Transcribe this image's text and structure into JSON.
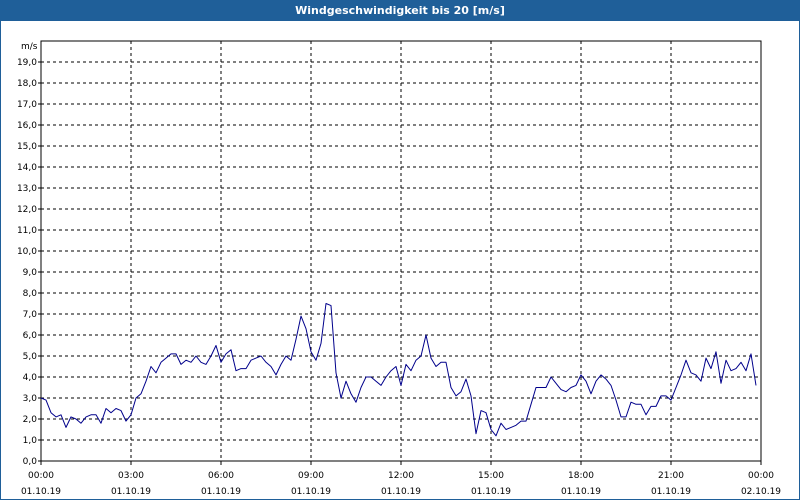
{
  "window": {
    "title": "Windgeschwindigkeit bis 20 [m/s]"
  },
  "colors": {
    "title_bar": "#1f5f99",
    "series_line": "#00008b",
    "grid": "#000000"
  },
  "chart_data": {
    "type": "line",
    "title": "Windgeschwindigkeit bis 20 [m/s]",
    "ylabel": "m/s",
    "xlabel": "",
    "ylim": [
      0,
      20
    ],
    "y_ticks": [
      "0,0",
      "1,0",
      "2,0",
      "3,0",
      "4,0",
      "5,0",
      "6,0",
      "7,0",
      "8,0",
      "9,0",
      "10,0",
      "11,0",
      "12,0",
      "13,0",
      "14,0",
      "15,0",
      "16,0",
      "17,0",
      "18,0",
      "19,0"
    ],
    "x_ticks": [
      {
        "time": "00:00",
        "date": "01.10.19"
      },
      {
        "time": "03:00",
        "date": "01.10.19"
      },
      {
        "time": "06:00",
        "date": "01.10.19"
      },
      {
        "time": "09:00",
        "date": "01.10.19"
      },
      {
        "time": "12:00",
        "date": "01.10.19"
      },
      {
        "time": "15:00",
        "date": "01.10.19"
      },
      {
        "time": "18:00",
        "date": "01.10.19"
      },
      {
        "time": "21:00",
        "date": "01.10.19"
      },
      {
        "time": "00:00",
        "date": "02.10.19"
      }
    ],
    "grid": true,
    "series": [
      {
        "x": [
          "00:00",
          "00:10",
          "00:20",
          "00:30",
          "00:40",
          "00:50",
          "01:00",
          "01:10",
          "01:20",
          "01:30",
          "01:40",
          "01:50",
          "02:00",
          "02:10",
          "02:20",
          "02:30",
          "02:40",
          "02:50",
          "03:00",
          "03:10",
          "03:20",
          "03:30",
          "03:40",
          "03:50",
          "04:00",
          "04:10",
          "04:20",
          "04:30",
          "04:40",
          "04:50",
          "05:00",
          "05:10",
          "05:20",
          "05:30",
          "05:40",
          "05:50",
          "06:00",
          "06:10",
          "06:20",
          "06:30",
          "06:40",
          "06:50",
          "07:00",
          "07:10",
          "07:20",
          "07:30",
          "07:40",
          "07:50",
          "08:00",
          "08:10",
          "08:20",
          "08:30",
          "08:40",
          "08:50",
          "09:00",
          "09:10",
          "09:20",
          "09:30",
          "09:40",
          "09:50",
          "10:00",
          "10:10",
          "10:20",
          "10:30",
          "10:40",
          "10:50",
          "11:00",
          "11:10",
          "11:20",
          "11:30",
          "11:40",
          "11:50",
          "12:00",
          "12:10",
          "12:20",
          "12:30",
          "12:40",
          "12:50",
          "13:00",
          "13:10",
          "13:20",
          "13:30",
          "13:40",
          "13:50",
          "14:00",
          "14:10",
          "14:20",
          "14:30",
          "14:40",
          "14:50",
          "15:00",
          "15:10",
          "15:20",
          "15:30",
          "15:40",
          "15:50",
          "16:00",
          "16:10",
          "16:20",
          "16:30",
          "16:40",
          "16:50",
          "17:00",
          "17:10",
          "17:20",
          "17:30",
          "17:40",
          "17:50",
          "18:00",
          "18:10",
          "18:20",
          "18:30",
          "18:40",
          "18:50",
          "19:00",
          "19:10",
          "19:20",
          "19:30",
          "19:40",
          "19:50",
          "20:00",
          "20:10",
          "20:20",
          "20:30",
          "20:40",
          "20:50",
          "21:00",
          "21:10",
          "21:20",
          "21:30",
          "21:40",
          "21:50",
          "22:00",
          "22:10",
          "22:20",
          "22:30",
          "22:40",
          "22:50",
          "23:00",
          "23:10",
          "23:20",
          "23:30",
          "23:40",
          "23:50"
        ],
        "values": [
          3.0,
          2.9,
          2.3,
          2.1,
          2.2,
          1.6,
          2.1,
          2.0,
          1.8,
          2.1,
          2.2,
          2.2,
          1.8,
          2.5,
          2.3,
          2.5,
          2.4,
          1.9,
          2.2,
          3.0,
          3.2,
          3.8,
          4.5,
          4.2,
          4.7,
          4.9,
          5.1,
          5.1,
          4.6,
          4.8,
          4.7,
          5.0,
          4.7,
          4.6,
          5.0,
          5.5,
          4.7,
          5.1,
          5.3,
          4.3,
          4.4,
          4.4,
          4.8,
          4.9,
          5.0,
          4.7,
          4.5,
          4.1,
          4.6,
          5.0,
          4.8,
          5.8,
          6.9,
          6.3,
          5.2,
          4.8,
          5.6,
          7.5,
          7.4,
          4.2,
          3.0,
          3.8,
          3.2,
          2.8,
          3.5,
          4.0,
          4.0,
          3.8,
          3.6,
          4.0,
          4.3,
          4.5,
          3.6,
          4.6,
          4.3,
          4.8,
          5.0,
          6.0,
          4.9,
          4.5,
          4.7,
          4.7,
          3.5,
          3.1,
          3.3,
          3.9,
          3.1,
          1.3,
          2.4,
          2.3,
          1.5,
          1.2,
          1.8,
          1.5,
          1.6,
          1.7,
          1.9,
          1.9,
          2.7,
          3.5,
          3.5,
          3.5,
          4.0,
          3.7,
          3.4,
          3.3,
          3.5,
          3.6,
          4.1,
          3.8,
          3.2,
          3.8,
          4.1,
          3.9,
          3.6,
          2.9,
          2.1,
          2.1,
          2.8,
          2.7,
          2.7,
          2.2,
          2.6,
          2.6,
          3.1,
          3.1,
          2.9,
          3.5,
          4.1,
          4.8,
          4.2,
          4.1,
          3.8,
          4.9,
          4.4,
          5.2,
          3.7,
          4.8,
          4.3,
          4.4,
          4.7,
          4.3,
          5.1,
          3.6
        ]
      }
    ]
  }
}
